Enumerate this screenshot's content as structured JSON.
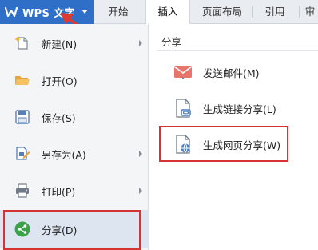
{
  "app": {
    "title": "WPS 文字"
  },
  "tabs": [
    {
      "label": "开始"
    },
    {
      "label": "插入"
    },
    {
      "label": "页面布局"
    },
    {
      "label": "引用"
    },
    {
      "label": "审"
    }
  ],
  "menu": {
    "items": [
      {
        "label": "新建(N)",
        "icon": "new-document-icon",
        "has_submenu": true
      },
      {
        "label": "打开(O)",
        "icon": "folder-open-icon",
        "has_submenu": false
      },
      {
        "label": "保存(S)",
        "icon": "save-icon",
        "has_submenu": false
      },
      {
        "label": "另存为(A)",
        "icon": "save-as-icon",
        "has_submenu": true
      },
      {
        "label": "打印(P)",
        "icon": "printer-icon",
        "has_submenu": true
      },
      {
        "label": "分享(D)",
        "icon": "share-icon",
        "has_submenu": true,
        "selected": true
      }
    ]
  },
  "share_panel": {
    "header": "分享",
    "items": [
      {
        "label": "发送邮件(M)",
        "icon": "mail-icon"
      },
      {
        "label": "生成链接分享(L)",
        "icon": "link-share-icon"
      },
      {
        "label": "生成网页分享(W)",
        "icon": "web-share-icon"
      }
    ]
  },
  "colors": {
    "accent": "#2f6fc7",
    "highlight_box": "#d63434",
    "selected_bg": "#dce5f0",
    "share_green": "#3aa34a"
  }
}
